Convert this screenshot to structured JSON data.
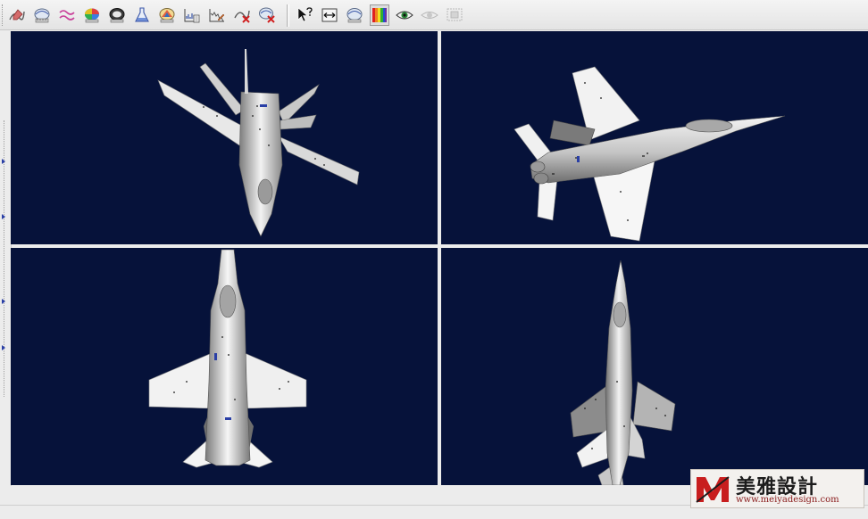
{
  "toolbar": {
    "buttons": [
      {
        "icon": "graph-pen-icon"
      },
      {
        "icon": "contour-gauge-icon"
      },
      {
        "icon": "wave-lines-icon"
      },
      {
        "icon": "color-wheel-icon"
      },
      {
        "icon": "gauge-dark-icon"
      },
      {
        "icon": "flask-icon"
      },
      {
        "icon": "palette-icon"
      },
      {
        "icon": "chart-data-icon"
      },
      {
        "icon": "noisy-chart-icon"
      },
      {
        "icon": "delete-graph-icon"
      },
      {
        "icon": "delete-gauge-icon"
      },
      {
        "icon": "help-pointer-icon"
      },
      {
        "icon": "fit-width-icon"
      },
      {
        "icon": "gauge-scale-icon"
      },
      {
        "icon": "color-spectrum-icon",
        "pressed": true
      },
      {
        "icon": "eye-icon"
      },
      {
        "icon": "eye-disabled-icon"
      },
      {
        "icon": "screen-select-icon"
      }
    ]
  },
  "viewports": [
    {
      "name": "viewport-top-left",
      "view": "perspective"
    },
    {
      "name": "viewport-top-right",
      "view": "side-perspective"
    },
    {
      "name": "viewport-bottom-left",
      "view": "top"
    },
    {
      "name": "viewport-bottom-right",
      "view": "front-perspective"
    }
  ],
  "colors": {
    "viewport_bg": "#06123a",
    "aircraft_light": "#f4f4f4",
    "aircraft_mid": "#b8b8b8",
    "aircraft_dark": "#6e6e6e",
    "accent_blue": "#2a3fa6",
    "spectrum_red": "#e02020"
  },
  "watermark": {
    "brand": "美雅設計",
    "url": "www.meiyadesign.com"
  }
}
